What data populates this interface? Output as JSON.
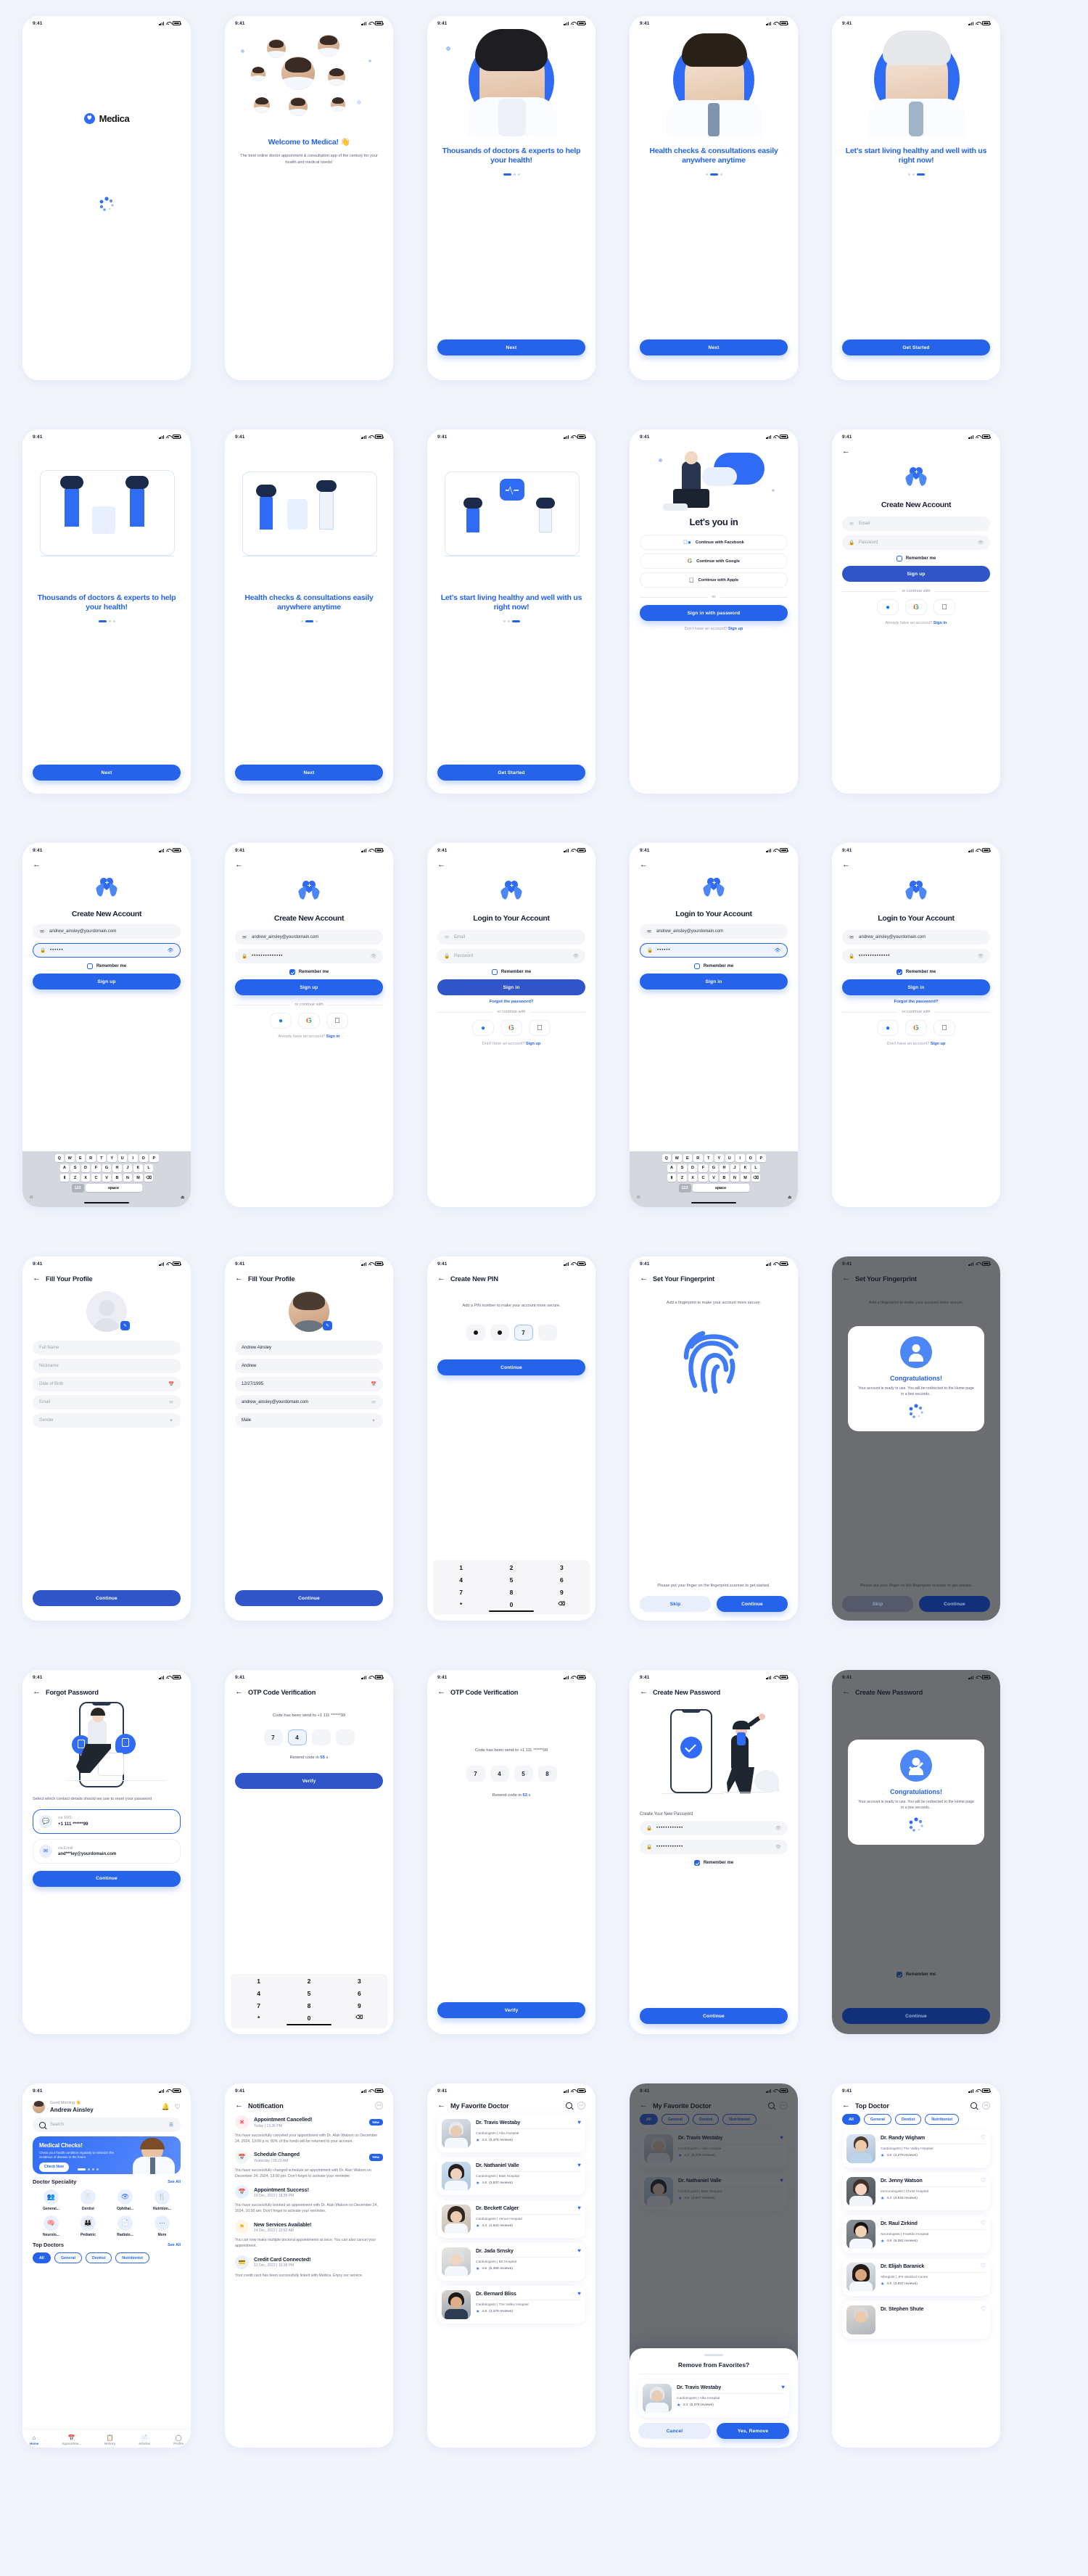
{
  "brand": {
    "name": "Medica",
    "accent": "#2563eb",
    "accent_light": "#4c86f7"
  },
  "statusbar": {
    "time": "9:41"
  },
  "screens": {
    "splash": {
      "name": "Medica"
    },
    "welcome": {
      "title": "Welcome to Medica! 👋",
      "subtitle": "The best online doctor appoinment & consultation app of the century for your health and medical needs!"
    },
    "onboarding": [
      {
        "title": "Thousands of doctors & experts to help your health!",
        "cta": "Next",
        "dot": 0
      },
      {
        "title": "Health checks & consultations easily anywhere anytime",
        "cta": "Next",
        "dot": 1
      },
      {
        "title": "Let's start living healthy and well with us right now!",
        "cta": "Get Started",
        "dot": 2
      }
    ],
    "lets_you_in": {
      "title": "Let's you in",
      "options": [
        {
          "label": "Continue with Facebook",
          "icon": "facebook-icon"
        },
        {
          "label": "Continue with Google",
          "icon": "google-icon"
        },
        {
          "label": "Continue with Apple",
          "icon": "apple-icon"
        }
      ],
      "divider": "or",
      "cta": "Sign in with password",
      "foot_text": "Don't have an account?",
      "foot_link": "Sign up"
    },
    "signup": {
      "title": "Create New Account",
      "email_placeholder": "Email",
      "password_placeholder": "Password",
      "email_value": "andrew_ainsley@yourdomain.com",
      "password_masked_short": "••••••",
      "password_masked_long": "••••••••••••••",
      "remember": "Remember me",
      "cta": "Sign up",
      "divider": "or continue with",
      "foot_text": "Already have an account?",
      "foot_link": "Sign in"
    },
    "login": {
      "title": "Login to Your Account",
      "email_placeholder": "Email",
      "password_placeholder": "Password",
      "email_value": "andrew_ainsley@yourdomain.com",
      "password_masked_short": "••••••",
      "password_masked_long": "••••••••••••••",
      "remember": "Remember me",
      "cta": "Sign in",
      "forgot": "Forgot the password?",
      "divider": "or continue with",
      "foot_text": "Don't have an account?",
      "foot_link": "Sign up"
    },
    "profile": {
      "title": "Fill Your Profile",
      "fields_empty": [
        "Full Name",
        "Nickname",
        "Date of Birth",
        "Email",
        "Gender"
      ],
      "fields_filled": [
        "Andrew Ainsley",
        "Andrew",
        "12/27/1995",
        "andrew_ainsley@yourdomain.com",
        "Male"
      ],
      "cta": "Continue"
    },
    "pin": {
      "title": "Create New PIN",
      "desc": "Add a PIN number to make your account more secure.",
      "digits": [
        "•",
        "•",
        "7",
        ""
      ],
      "cta": "Continue",
      "keys": [
        "1",
        "2",
        "3",
        "4",
        "5",
        "6",
        "7",
        "8",
        "9",
        "*",
        "0",
        "⌫"
      ]
    },
    "fingerprint": {
      "title": "Set Your Fingerprint",
      "desc": "Add a fingerprint to make your account more secure.",
      "hint": "Please put your finger on the fingerprint scanner to get started.",
      "skip": "Skip",
      "cta": "Continue",
      "congrats_title": "Congratulations!",
      "congrats_desc": "Your account is ready to use. You will be redirected to the Home page in a few seconds.."
    },
    "forgot": {
      "title": "Forgot Password",
      "desc": "Select which contact details should we use to reset your password",
      "methods": [
        {
          "label": "via SMS:",
          "value": "+1 111 ******99",
          "icon": "chat-icon"
        },
        {
          "label": "via Email:",
          "value": "and***ley@yourdomain.com",
          "icon": "mail-icon"
        }
      ],
      "cta": "Continue"
    },
    "otp": {
      "title": "OTP Code Verification",
      "sent_to": "Code has been send to +1 111 ******99",
      "digits_partial": [
        "7",
        "4",
        "",
        ""
      ],
      "digits_full": [
        "7",
        "4",
        "5",
        "8"
      ],
      "resend_prefix": "Resend code in",
      "resend_seconds_a": "55",
      "resend_seconds_b": "53",
      "resend_suffix": "s",
      "cta": "Verify",
      "keys": [
        "1",
        "2",
        "3",
        "4",
        "5",
        "6",
        "7",
        "8",
        "9",
        "*",
        "0",
        "⌫"
      ]
    },
    "new_password": {
      "title": "Create New Password",
      "label": "Create Your New Password",
      "password_masked": "••••••••••••",
      "remember": "Remember me",
      "cta": "Continue",
      "congrats_title": "Congratulations!",
      "congrats_desc": "Your account is ready to use. You will be redirected to the Home page in a few seconds.."
    },
    "home": {
      "greeting": "Good Morning 👋",
      "user": "Andrew Ainsley",
      "search_placeholder": "Search",
      "promo_title": "Medical Checks!",
      "promo_desc": "Check your health condition regularly to minimize the incidence of disease in the future.",
      "promo_cta": "Check Now",
      "speciality_title": "Doctor Speciality",
      "see_all": "See All",
      "specialities": [
        {
          "label": "General...",
          "icon": "general-icon"
        },
        {
          "label": "Dentist",
          "icon": "tooth-icon"
        },
        {
          "label": "Ophthal...",
          "icon": "eye-icon"
        },
        {
          "label": "Nutrition...",
          "icon": "nutrition-icon"
        },
        {
          "label": "Neurolo...",
          "icon": "brain-icon"
        },
        {
          "label": "Pediatric",
          "icon": "children-icon"
        },
        {
          "label": "Radiolo...",
          "icon": "xray-icon"
        },
        {
          "label": "More",
          "icon": "more-icon"
        }
      ],
      "top_doctors_title": "Top Doctors",
      "filters": [
        "All",
        "General",
        "Dentist",
        "Nutritionist"
      ],
      "tabs": [
        {
          "label": "Home",
          "icon": "home-icon",
          "active": true
        },
        {
          "label": "Appointme...",
          "icon": "calendar-icon",
          "active": false
        },
        {
          "label": "History",
          "icon": "history-icon",
          "active": false
        },
        {
          "label": "Articles",
          "icon": "article-icon",
          "active": false
        },
        {
          "label": "Profile",
          "icon": "person-icon",
          "active": false
        }
      ]
    },
    "notification": {
      "title": "Notification",
      "items": [
        {
          "title": "Appointment Cancelled!",
          "meta": "Today  |  15:36 PM",
          "badge": "New",
          "icon": "cancel-icon",
          "color": "#fb5f6d",
          "bg": "#ffeef0",
          "desc": "You have successfully canceled your appointment with Dr. Alan Watson on December 24, 2024, 13:00 p.m. 80% of the funds will be returned to your account."
        },
        {
          "title": "Schedule Changed",
          "meta": "Yesterday  |  09:23 AM",
          "badge": "New",
          "icon": "calendar-icon",
          "color": "#25c08a",
          "bg": "#eef7f2",
          "desc": "You have successfully changed schedule an appointment with Dr. Alan Watson on December 24, 2024, 13:00 pm. Don't forget to activate your reminder."
        },
        {
          "title": "Appointment Success!",
          "meta": "19 Dec, 2022  |  18:35 PM",
          "badge": "",
          "icon": "calendar-icon",
          "color": "#2f6bf5",
          "bg": "#e8f0ff",
          "desc": "You have successfully booked an appointment with Dr. Alan Watson on December 24, 2024, 10:00 am. Don't forget to activate your reminder."
        },
        {
          "title": "New Services Available!",
          "meta": "14 Dec, 2022  |  10:52 AM",
          "badge": "",
          "icon": "services-icon",
          "color": "#f6a81e",
          "bg": "#fff5e4",
          "desc": "You can now make multiple doctoral appointments at once. You can also cancel your appointment."
        },
        {
          "title": "Credit Card Connected!",
          "meta": "12 Dec, 2022  |  15:38 PM",
          "badge": "",
          "icon": "card-icon",
          "color": "#2f6bf5",
          "bg": "#e8f0ff",
          "desc": "Your credit card has been successfully linked with Medica. Enjoy our service."
        }
      ]
    },
    "favorites": {
      "title": "My Favorite Doctor",
      "filters": [
        "All",
        "General",
        "Dentist",
        "Nutritionist"
      ],
      "doctors": [
        {
          "name": "Dr. Travis Westaby",
          "spec": "Cardiologists  |  Alka Hospital",
          "rating": "4.3",
          "reviews": "(5,376 reviews)",
          "fav": true
        },
        {
          "name": "Dr. Nathaniel Valle",
          "spec": "Cardiologists  |  B&B Hospital",
          "rating": "4.6",
          "reviews": "(3,837 reviews)",
          "fav": true
        },
        {
          "name": "Dr. Beckett Calger",
          "spec": "Cardiologists  |  Venus Hospital",
          "rating": "4.4",
          "reviews": "(4,942 reviews)",
          "fav": true
        },
        {
          "name": "Dr. Jada Srnsky",
          "spec": "Cardiologists  |  Bir Hospital",
          "rating": "4.6",
          "reviews": "(5,366 reviews)",
          "fav": true
        },
        {
          "name": "Dr. Bernard Bliss",
          "spec": "Cardiologists  |  The Valley Hospital",
          "rating": "4.8",
          "reviews": "(3,279 reviews)",
          "fav": true
        }
      ],
      "remove_sheet": {
        "title": "Remove from Favorites?",
        "cancel": "Cancel",
        "confirm": "Yes, Remove"
      }
    },
    "top_doctor": {
      "title": "Top Doctor",
      "filters": [
        "All",
        "General",
        "Dentist",
        "Nutritionist"
      ],
      "doctors": [
        {
          "name": "Dr. Randy Wigham",
          "spec": "Cardiologists  |  The Valley Hospital",
          "rating": "4.8",
          "reviews": "(4,279 reviews)",
          "fav": false
        },
        {
          "name": "Dr. Jenny Watson",
          "spec": "Immunologists  |  Christ Hospital",
          "rating": "4.4",
          "reviews": "(4,942 reviews)",
          "fav": false
        },
        {
          "name": "Dr. Raul Zirkind",
          "spec": "Neurologists  |  Franklin Hospital",
          "rating": "4.8",
          "reviews": "(6,362 reviews)",
          "fav": false
        },
        {
          "name": "Dr. Elijah Baranick",
          "spec": "Allergists  |  JFK Medical Center",
          "rating": "4.6",
          "reviews": "(3,837 reviews)",
          "fav": false
        },
        {
          "name": "Dr. Stephen Shute",
          "spec": "",
          "rating": "",
          "reviews": "",
          "fav": false
        }
      ]
    }
  },
  "keyboard": {
    "row1": [
      "Q",
      "W",
      "E",
      "R",
      "T",
      "Y",
      "U",
      "I",
      "O",
      "P"
    ],
    "row2": [
      "A",
      "S",
      "D",
      "F",
      "G",
      "H",
      "J",
      "K",
      "L"
    ],
    "row3": [
      "⬆",
      "Z",
      "X",
      "C",
      "V",
      "B",
      "N",
      "M",
      "⌫"
    ],
    "row4": [
      "123",
      "space",
      "✓"
    ],
    "emoji": "☺",
    "mic": "🎤"
  }
}
